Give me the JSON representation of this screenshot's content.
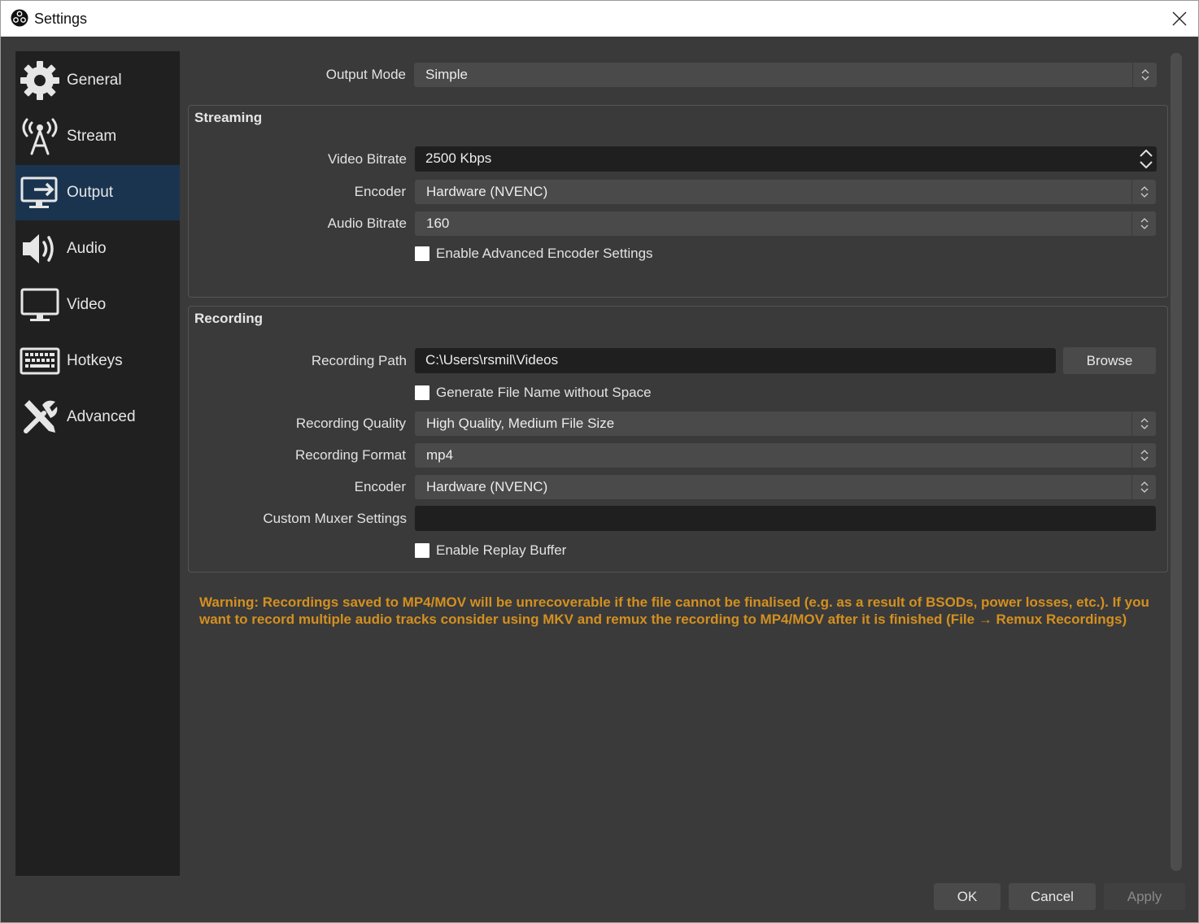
{
  "window": {
    "title": "Settings"
  },
  "sidebar": {
    "items": [
      {
        "label": "General",
        "icon": "gear-icon"
      },
      {
        "label": "Stream",
        "icon": "broadcast-tower-icon"
      },
      {
        "label": "Output",
        "icon": "monitor-output-icon",
        "active": true
      },
      {
        "label": "Audio",
        "icon": "speaker-icon"
      },
      {
        "label": "Video",
        "icon": "monitor-icon"
      },
      {
        "label": "Hotkeys",
        "icon": "keyboard-icon"
      },
      {
        "label": "Advanced",
        "icon": "tools-icon"
      }
    ]
  },
  "output_mode": {
    "label": "Output Mode",
    "value": "Simple"
  },
  "streaming": {
    "title": "Streaming",
    "video_bitrate": {
      "label": "Video Bitrate",
      "value": "2500 Kbps"
    },
    "encoder": {
      "label": "Encoder",
      "value": "Hardware (NVENC)"
    },
    "audio_bitrate": {
      "label": "Audio Bitrate",
      "value": "160"
    },
    "advanced_encoder": {
      "label": "Enable Advanced Encoder Settings",
      "checked": false
    }
  },
  "recording": {
    "title": "Recording",
    "path": {
      "label": "Recording Path",
      "value": "C:\\Users\\rsmil\\Videos",
      "browse_label": "Browse"
    },
    "no_space": {
      "label": "Generate File Name without Space",
      "checked": false
    },
    "quality": {
      "label": "Recording Quality",
      "value": "High Quality, Medium File Size"
    },
    "format": {
      "label": "Recording Format",
      "value": "mp4"
    },
    "encoder": {
      "label": "Encoder",
      "value": "Hardware (NVENC)"
    },
    "muxer": {
      "label": "Custom Muxer Settings",
      "value": ""
    },
    "replay_buffer": {
      "label": "Enable Replay Buffer",
      "checked": false
    }
  },
  "warning": "Warning: Recordings saved to MP4/MOV will be unrecoverable if the file cannot be finalised (e.g. as a result of BSODs, power losses, etc.). If you want to record multiple audio tracks consider using MKV and remux the recording to MP4/MOV after it is finished (File → Remux Recordings)",
  "buttons": {
    "ok": "OK",
    "cancel": "Cancel",
    "apply": "Apply"
  },
  "colors": {
    "warning": "#d4901f",
    "active_item": "#1a3450",
    "panel": "#3a3a3a",
    "sidebar": "#202020"
  }
}
